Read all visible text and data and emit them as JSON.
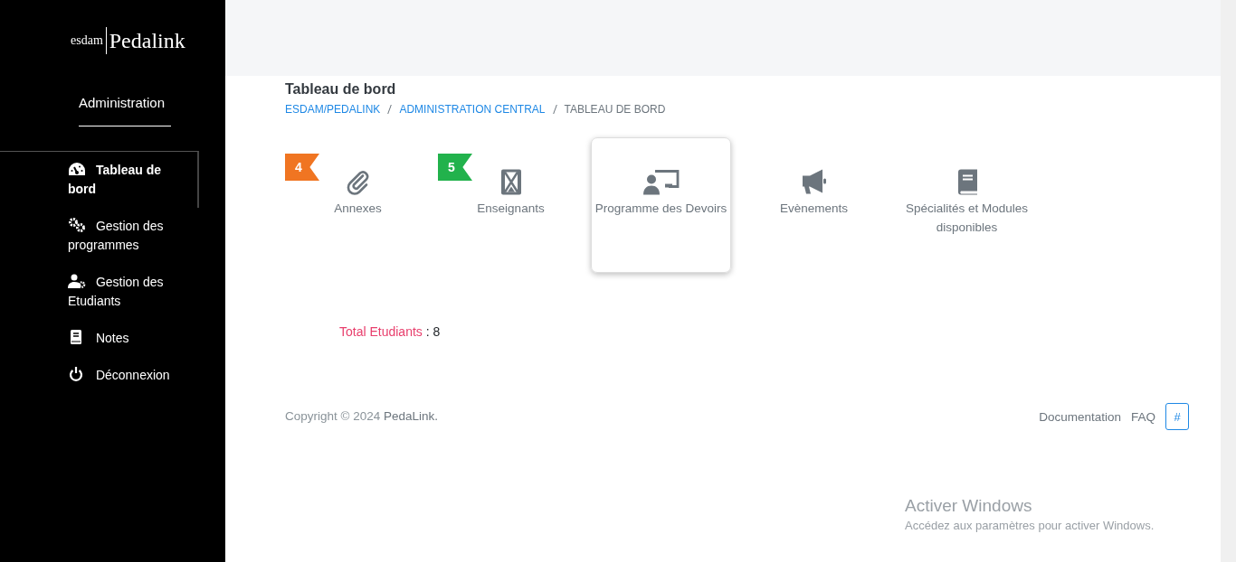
{
  "logo": {
    "mark": "esdam",
    "name": "Pedalink"
  },
  "sidebar": {
    "heading": "Administration",
    "items": [
      {
        "label": "Tableau de bord",
        "kind": "gauge",
        "selected": true
      },
      {
        "label": "Gestion des programmes",
        "kind": "gears",
        "selected": false
      },
      {
        "label": "Gestion des Etudiants",
        "kind": "usergear",
        "selected": false
      },
      {
        "label": "Notes",
        "kind": "book",
        "selected": false
      },
      {
        "label": "Déconnexion",
        "kind": "power",
        "selected": false
      }
    ]
  },
  "page": {
    "title": "Tableau de bord",
    "breadcrumb": [
      {
        "label": "ESDAM/PEDALINK",
        "link": true
      },
      {
        "label": "ADMINISTRATION CENTRAL",
        "link": true
      },
      {
        "label": "TABLEAU DE BORD",
        "link": false
      }
    ]
  },
  "tiles": [
    {
      "label": "Annexes",
      "kind": "paperclip",
      "badge": "4",
      "color": "#f07522",
      "selected": false
    },
    {
      "label": "Enseignants",
      "kind": "hourglass",
      "badge": "5",
      "color": "#22b24c",
      "selected": false
    },
    {
      "label": "Programme des Devoirs",
      "kind": "teacher",
      "selected": true
    },
    {
      "label": "Evènements",
      "kind": "megaphone",
      "selected": false
    },
    {
      "label": "Spécialités et Modules disponibles",
      "kind": "book",
      "selected": false
    }
  ],
  "total": {
    "label": "Total Etudiants",
    "separator": ":",
    "value": "8"
  },
  "footer": {
    "copyright": "Copyright © 2024 ",
    "brand": "PedaLink.",
    "links": [
      "Documentation",
      "FAQ"
    ],
    "hash_button": "#"
  },
  "os_notice": {
    "title": "Activer Windows",
    "text": "Accédez aux paramètres pour activer Windows."
  }
}
